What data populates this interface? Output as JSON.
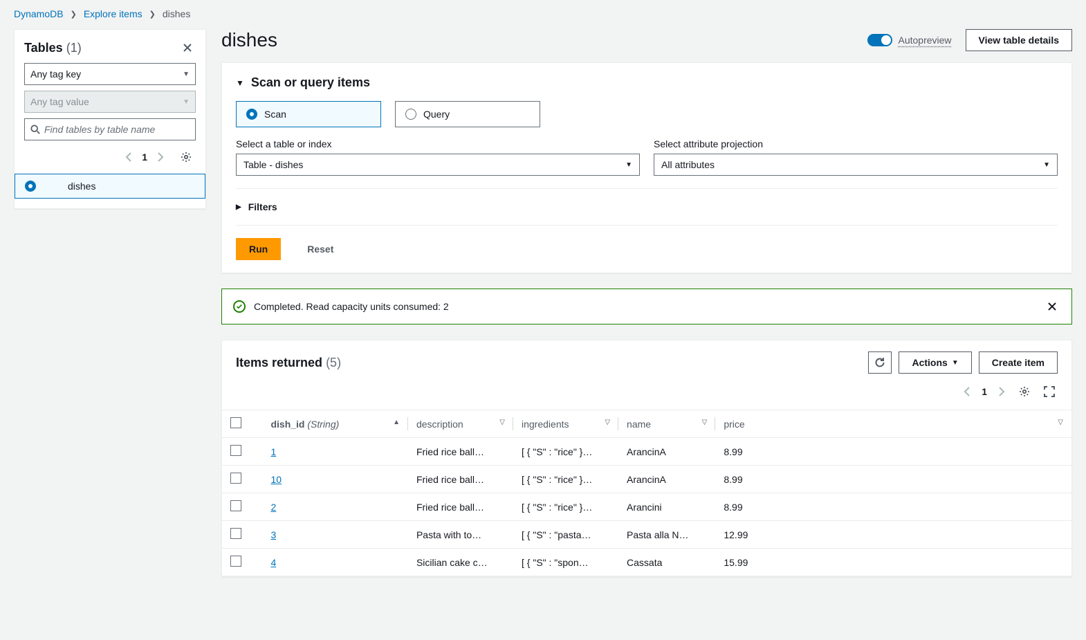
{
  "breadcrumb": {
    "root": "DynamoDB",
    "mid": "Explore items",
    "current": "dishes"
  },
  "sidebar": {
    "title": "Tables",
    "count": "(1)",
    "tag_key_select": "Any tag key",
    "tag_value_select": "Any tag value",
    "search_placeholder": "Find tables by table name",
    "page": "1",
    "items": [
      {
        "label": "dishes"
      }
    ]
  },
  "page": {
    "title": "dishes",
    "autopreview_label": "Autopreview",
    "view_details": "View table details"
  },
  "query_panel": {
    "header": "Scan or query items",
    "scan_label": "Scan",
    "query_label": "Query",
    "table_field_label": "Select a table or index",
    "table_select_value": "Table - dishes",
    "projection_field_label": "Select attribute projection",
    "projection_select_value": "All attributes",
    "filters_label": "Filters",
    "run_label": "Run",
    "reset_label": "Reset"
  },
  "status": {
    "message": "Completed. Read capacity units consumed: 2"
  },
  "results": {
    "header": "Items returned",
    "count": "(5)",
    "actions_label": "Actions",
    "create_label": "Create item",
    "page": "1",
    "columns": {
      "id": "dish_id",
      "id_type": "(String)",
      "description": "description",
      "ingredients": "ingredients",
      "name": "name",
      "price": "price"
    },
    "rows": [
      {
        "id": "1",
        "description": "Fried rice ball…",
        "ingredients": "[ { \"S\" : \"rice\" }…",
        "name": "ArancinA",
        "price": "8.99"
      },
      {
        "id": "10",
        "description": "Fried rice ball…",
        "ingredients": "[ { \"S\" : \"rice\" }…",
        "name": "ArancinA",
        "price": "8.99"
      },
      {
        "id": "2",
        "description": "Fried rice ball…",
        "ingredients": "[ { \"S\" : \"rice\" }…",
        "name": "Arancini",
        "price": "8.99"
      },
      {
        "id": "3",
        "description": "Pasta with to…",
        "ingredients": "[ { \"S\" : \"pasta…",
        "name": "Pasta alla N…",
        "price": "12.99"
      },
      {
        "id": "4",
        "description": "Sicilian cake c…",
        "ingredients": "[ { \"S\" : \"spon…",
        "name": "Cassata",
        "price": "15.99"
      }
    ]
  }
}
